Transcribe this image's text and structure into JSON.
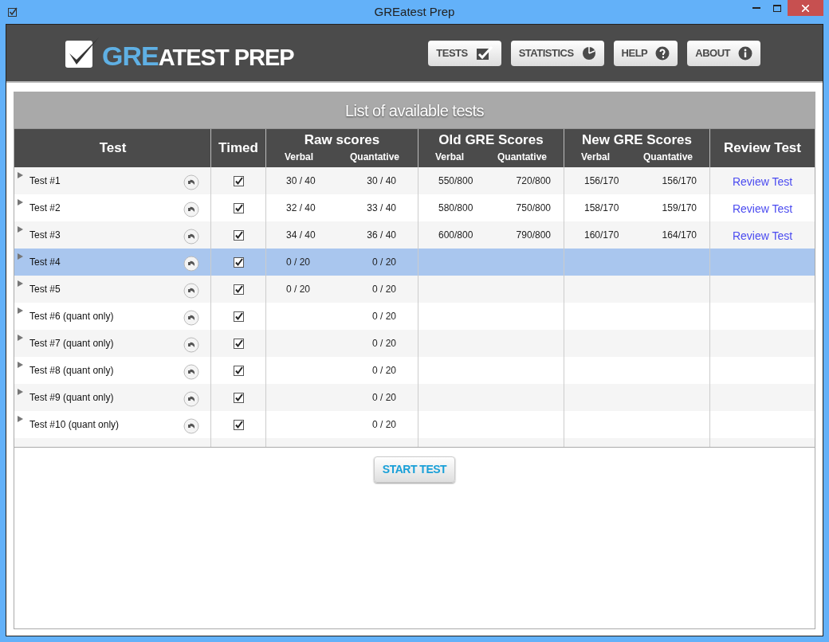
{
  "window": {
    "title": "GREatest Prep"
  },
  "logo": {
    "highlight": "GRE",
    "rest": "ATEST PREP"
  },
  "nav": [
    {
      "label": "TESTS",
      "kind": "check"
    },
    {
      "label": "STATISTICS",
      "kind": "pie"
    },
    {
      "label": "HELP",
      "kind": "help"
    },
    {
      "label": "ABOUT",
      "kind": "info"
    }
  ],
  "panel_title": "List of available tests",
  "columns": {
    "test": "Test",
    "timed": "Timed",
    "review": "Review Test",
    "groups": [
      {
        "label": "Raw scores",
        "verbal": "Verbal",
        "quant": "Quantative"
      },
      {
        "label": "Old GRE Scores",
        "verbal": "Verbal",
        "quant": "Quantative"
      },
      {
        "label": "New GRE Scores",
        "verbal": "Verbal",
        "quant": "Quantative"
      }
    ]
  },
  "rows": [
    {
      "name": "Test #1",
      "expanded": false,
      "timed": true,
      "selected": false,
      "scores": [
        {
          "verbal": "30 / 40",
          "quant": "30 / 40"
        },
        {
          "verbal": "550/800",
          "quant": "720/800"
        },
        {
          "verbal": "156/170",
          "quant": "156/170"
        }
      ],
      "review": "Review Test"
    },
    {
      "name": "Test #2",
      "expanded": false,
      "timed": true,
      "selected": false,
      "scores": [
        {
          "verbal": "32 / 40",
          "quant": "33 / 40"
        },
        {
          "verbal": "580/800",
          "quant": "750/800"
        },
        {
          "verbal": "158/170",
          "quant": "159/170"
        }
      ],
      "review": "Review Test"
    },
    {
      "name": "Test #3",
      "expanded": false,
      "timed": true,
      "selected": false,
      "scores": [
        {
          "verbal": "34 / 40",
          "quant": "36 / 40"
        },
        {
          "verbal": "600/800",
          "quant": "790/800"
        },
        {
          "verbal": "160/170",
          "quant": "164/170"
        }
      ],
      "review": "Review Test"
    },
    {
      "name": "Test #4",
      "expanded": false,
      "timed": true,
      "selected": true,
      "scores": [
        {
          "verbal": "0 / 20",
          "quant": "0 / 20"
        }
      ]
    },
    {
      "name": "Test #5",
      "expanded": false,
      "timed": true,
      "selected": false,
      "scores": [
        {
          "verbal": "0 / 20",
          "quant": "0 / 20"
        }
      ]
    },
    {
      "name": "Test #6 (quant only)",
      "expanded": false,
      "timed": true,
      "selected": false,
      "scores": [
        {
          "quant": "0 / 20"
        }
      ]
    },
    {
      "name": "Test #7 (quant only)",
      "expanded": false,
      "timed": true,
      "selected": false,
      "scores": [
        {
          "quant": "0 / 20"
        }
      ]
    },
    {
      "name": "Test #8 (quant only)",
      "expanded": false,
      "timed": true,
      "selected": false,
      "scores": [
        {
          "quant": "0 / 20"
        }
      ]
    },
    {
      "name": "Test #9 (quant only)",
      "expanded": false,
      "timed": true,
      "selected": false,
      "scores": [
        {
          "quant": "0 / 20"
        }
      ]
    },
    {
      "name": "Test #10 (quant only)",
      "expanded": false,
      "timed": true,
      "selected": false,
      "scores": [
        {
          "quant": "0 / 20"
        }
      ]
    }
  ],
  "start_button": "START TEST"
}
